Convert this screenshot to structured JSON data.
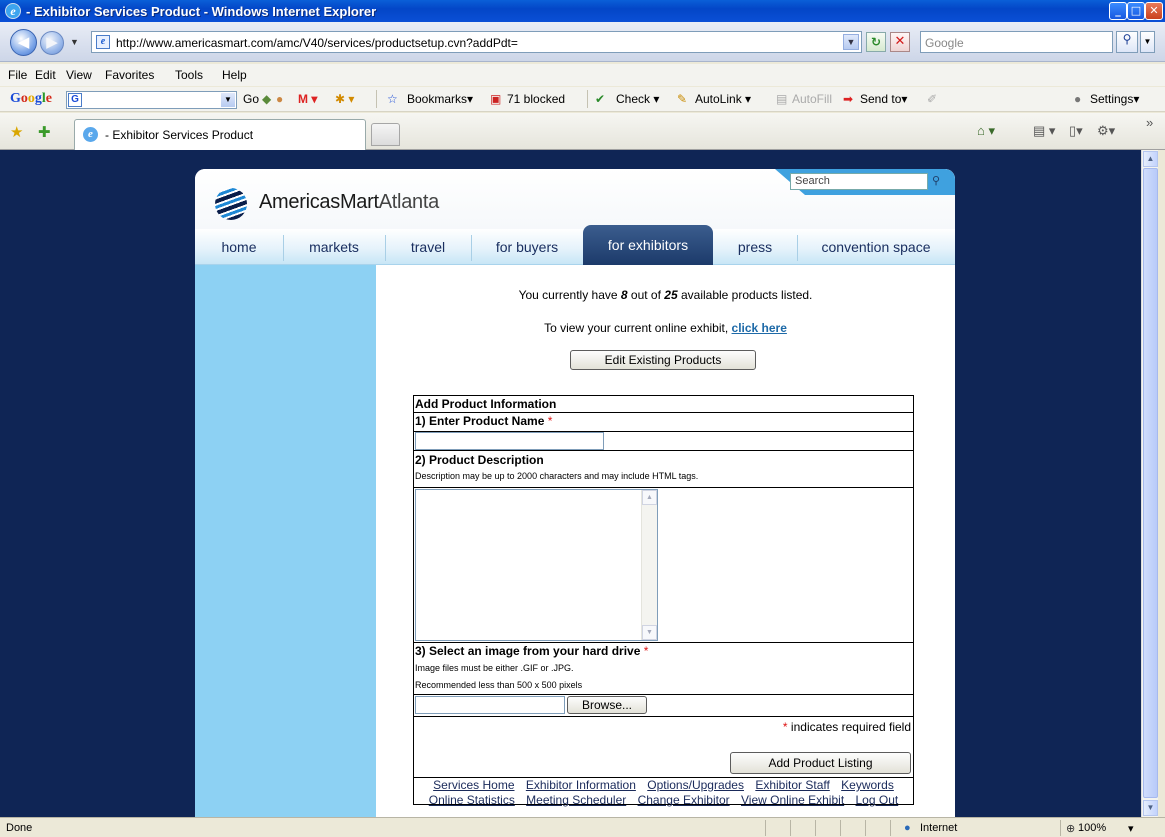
{
  "window": {
    "title": " - Exhibitor Services Product - Windows Internet Explorer",
    "min": "_",
    "max": "□",
    "close": "✕"
  },
  "address": {
    "url": "http://www.americasmart.com/amc/V40/services/productsetup.cvn?addPdt=",
    "search_placeholder": "Google"
  },
  "menu": [
    "File",
    "Edit",
    "View",
    "Favorites",
    "Tools",
    "Help"
  ],
  "google_toolbar": {
    "go": "Go",
    "bookmarks": "Bookmarks▾",
    "blocked": "71 blocked",
    "check": "Check ▾",
    "autolink": "AutoLink ▾",
    "autofill": "AutoFill",
    "sendto": "Send to▾",
    "settings": "Settings▾"
  },
  "tab": {
    "label": "- Exhibitor Services Product"
  },
  "site": {
    "logo": {
      "main": "AmericasMart",
      "sub": "Atlanta"
    },
    "search_placeholder": "Search",
    "nav": [
      "home",
      "markets",
      "travel",
      "for buyers",
      "for exhibitors",
      "press",
      "convention space"
    ],
    "active_nav": "for exhibitors"
  },
  "content": {
    "count_pre": "You currently have ",
    "count_current": "8",
    "count_mid": " out of ",
    "count_total": "25",
    "count_post": " available products listed.",
    "view_pre": "To view your current online exhibit, ",
    "view_link": "click here",
    "edit_button": "Edit Existing Products",
    "form_title": "Add Product Information",
    "step1": "1) Enter Product Name",
    "step2": "2) Product Description",
    "step2_note": "Description may be up to 2000 characters and may include HTML tags.",
    "step3": "3) Select an image from your hard drive",
    "step3_note1": "Image files must be either .GIF or .JPG.",
    "step3_note2": "Recommended less than 500 x 500 pixels",
    "browse": "Browse...",
    "required_note": "* indicates required field",
    "required_mark": "*",
    "add_button": "Add Product Listing",
    "footer_row1": [
      "Services Home",
      "Exhibitor Information",
      "Options/Upgrades",
      "Exhibitor Staff",
      "Keywords"
    ],
    "footer_row2": [
      "Online Statistics",
      "Meeting Scheduler",
      "Change Exhibitor",
      "View Online Exhibit",
      "Log Out"
    ]
  },
  "status": {
    "text": "Done",
    "zone": "Internet",
    "zoom": "100%"
  }
}
